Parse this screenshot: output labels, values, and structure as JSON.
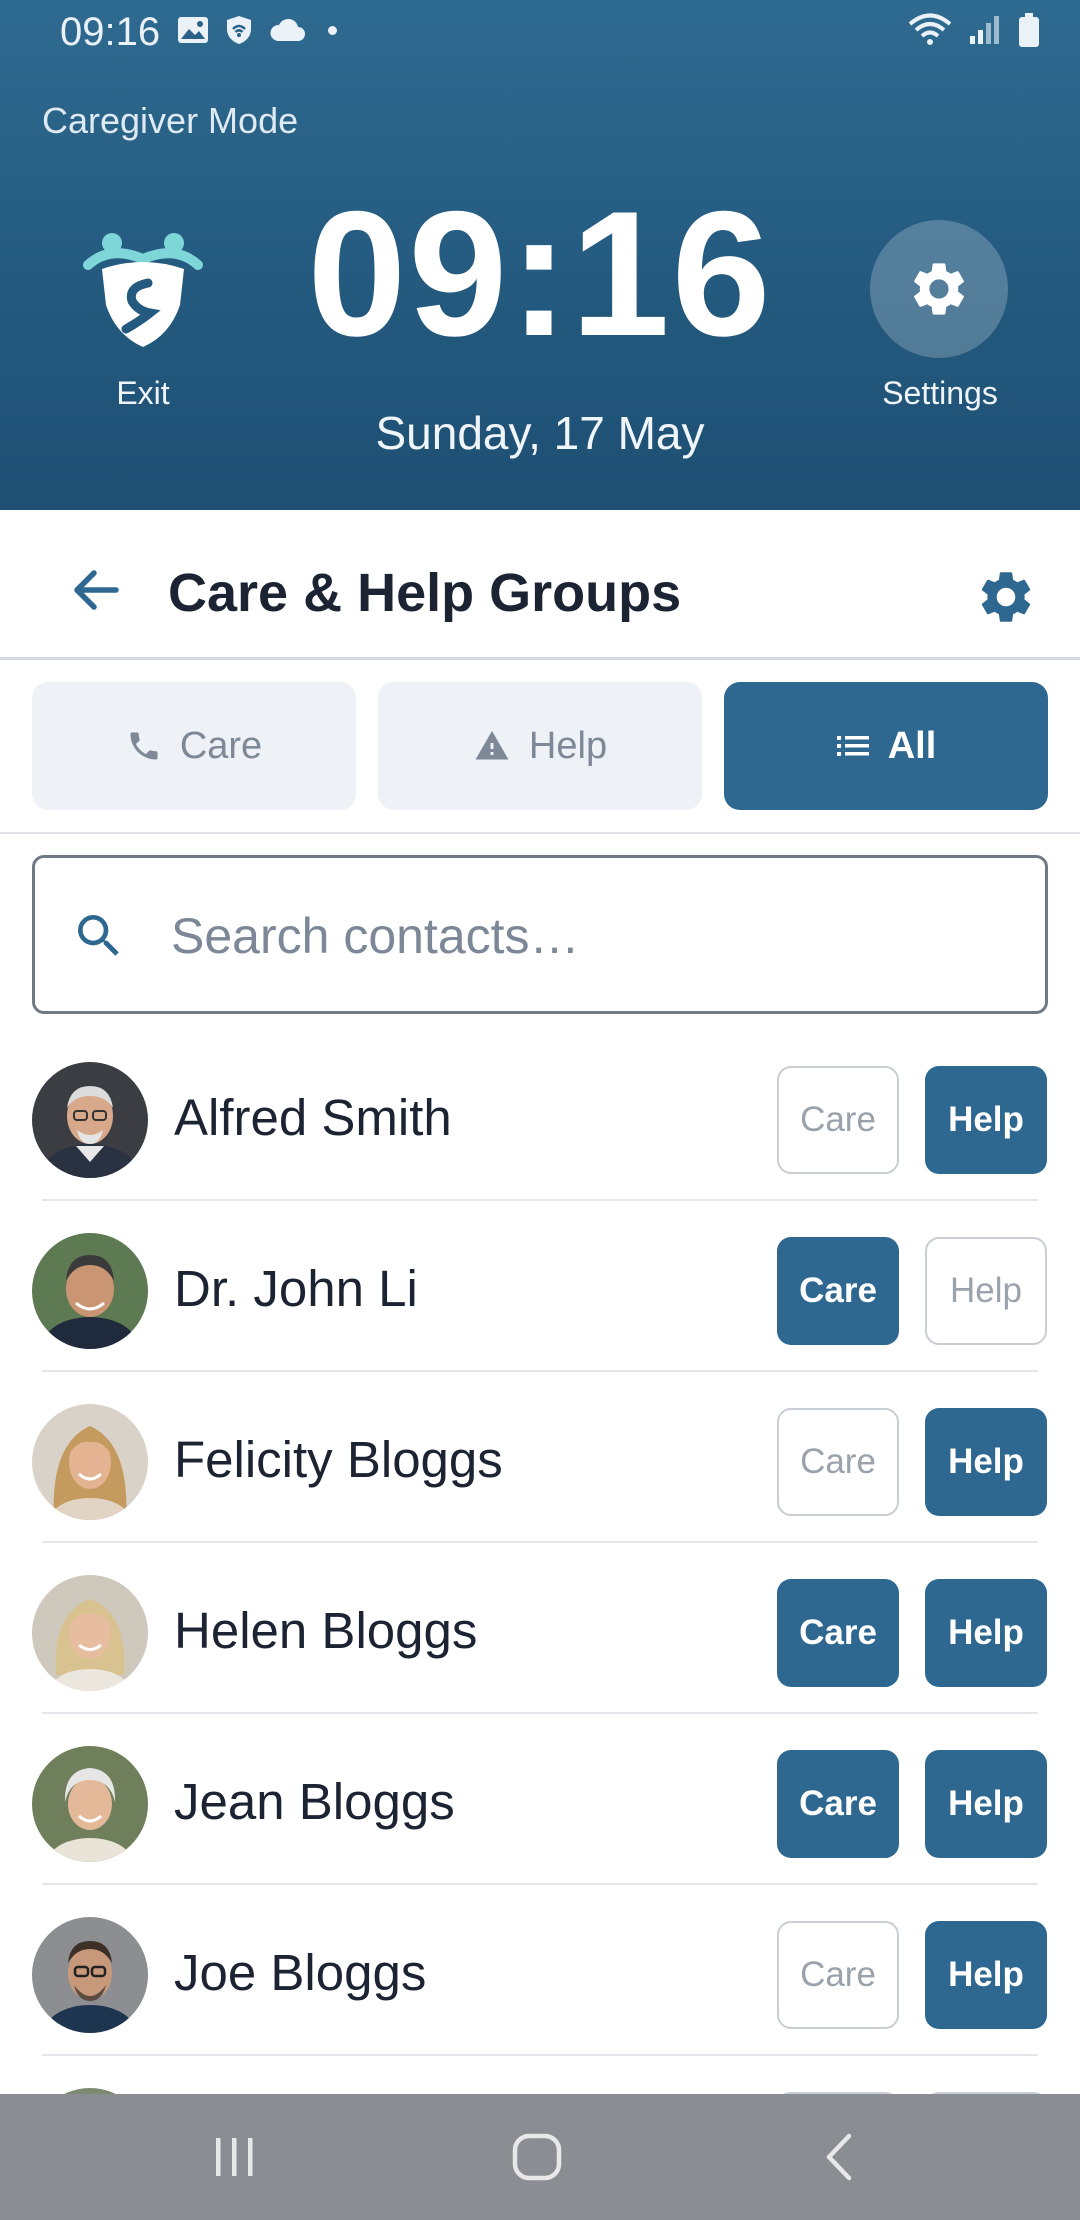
{
  "status_bar": {
    "time": "09:16"
  },
  "header": {
    "mode_label": "Caregiver Mode",
    "clock": "09:16",
    "date": "Sunday, 17 May",
    "exit_label": "Exit",
    "settings_label": "Settings"
  },
  "titlebar": {
    "title": "Care & Help Groups"
  },
  "tabs": [
    {
      "label": "Care",
      "icon": "phone-icon",
      "active": false
    },
    {
      "label": "Help",
      "icon": "warning-icon",
      "active": false
    },
    {
      "label": "All",
      "icon": "list-icon",
      "active": true
    }
  ],
  "search": {
    "placeholder": "Search contacts…",
    "value": ""
  },
  "contacts": [
    {
      "name": "Alfred Smith",
      "care": false,
      "help": true
    },
    {
      "name": "Dr. John Li",
      "care": true,
      "help": false
    },
    {
      "name": "Felicity Bloggs",
      "care": false,
      "help": true
    },
    {
      "name": "Helen Bloggs",
      "care": true,
      "help": true
    },
    {
      "name": "Jean Bloggs",
      "care": true,
      "help": true
    },
    {
      "name": "Joe Bloggs",
      "care": false,
      "help": true
    }
  ],
  "chips": {
    "care_label": "Care",
    "help_label": "Help"
  },
  "colors": {
    "header": "#245a7f",
    "accent": "#2e6890",
    "logo_teal": "#7fd6d9"
  }
}
